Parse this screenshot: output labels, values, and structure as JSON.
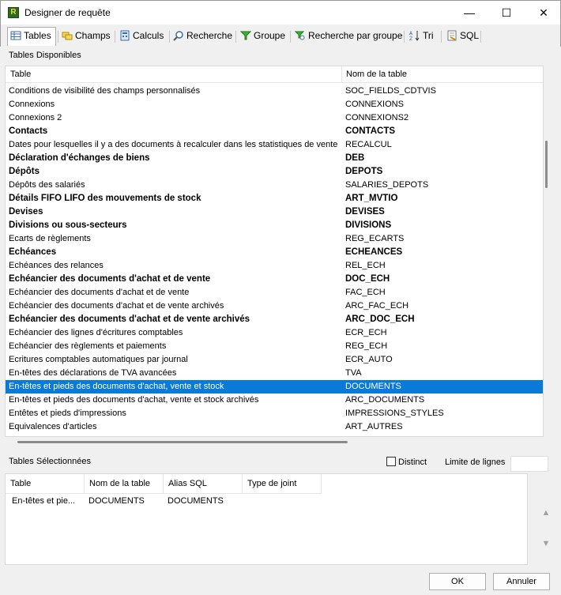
{
  "window": {
    "title": "Designer de requête",
    "app_icon_letter": "R",
    "minimize_glyph": "—",
    "maximize_glyph": "☐",
    "close_glyph": "✕"
  },
  "tabs": [
    {
      "label": "Tables",
      "icon": "table-icon",
      "active": true
    },
    {
      "label": "Champs",
      "icon": "fields-icon",
      "active": false
    },
    {
      "label": "Calculs",
      "icon": "calculator-icon",
      "active": false
    },
    {
      "label": "Recherche",
      "icon": "magnifier-icon",
      "active": false
    },
    {
      "label": "Groupe",
      "icon": "funnel-icon",
      "active": false
    },
    {
      "label": "Recherche par groupe",
      "icon": "group-search-icon",
      "active": false
    },
    {
      "label": "Tri",
      "icon": "sort-az-icon",
      "active": false
    },
    {
      "label": "SQL",
      "icon": "sql-icon",
      "active": false
    }
  ],
  "available": {
    "label": "Tables Disponibles",
    "columns": [
      "Table",
      "Nom de la table"
    ],
    "rows": [
      {
        "name": "Conditions de visibilité des champs personnalisés",
        "table": "SOC_FIELDS_CDTVIS",
        "bold": false,
        "selected": false
      },
      {
        "name": "Connexions",
        "table": "CONNEXIONS",
        "bold": false,
        "selected": false
      },
      {
        "name": "Connexions 2",
        "table": "CONNEXIONS2",
        "bold": false,
        "selected": false
      },
      {
        "name": "Contacts",
        "table": "CONTACTS",
        "bold": true,
        "selected": false
      },
      {
        "name": "Dates pour lesquelles il y a des documents à recalculer dans les statistiques de vente",
        "table": "RECALCUL",
        "bold": false,
        "selected": false
      },
      {
        "name": "Déclaration d'échanges de biens",
        "table": "DEB",
        "bold": true,
        "selected": false
      },
      {
        "name": "Dépôts",
        "table": "DEPOTS",
        "bold": true,
        "selected": false
      },
      {
        "name": "Dépôts des salariés",
        "table": "SALARIES_DEPOTS",
        "bold": false,
        "selected": false
      },
      {
        "name": "Détails FIFO LIFO des mouvements de stock",
        "table": "ART_MVTIO",
        "bold": true,
        "selected": false
      },
      {
        "name": "Devises",
        "table": "DEVISES",
        "bold": true,
        "selected": false
      },
      {
        "name": "Divisions ou sous-secteurs",
        "table": "DIVISIONS",
        "bold": true,
        "selected": false
      },
      {
        "name": "Ecarts de règlements",
        "table": "REG_ECARTS",
        "bold": false,
        "selected": false
      },
      {
        "name": "Echéances",
        "table": "ECHEANCES",
        "bold": true,
        "selected": false
      },
      {
        "name": "Echéances des relances",
        "table": "REL_ECH",
        "bold": false,
        "selected": false
      },
      {
        "name": "Echéancier des documents d'achat et de vente",
        "table": "DOC_ECH",
        "bold": true,
        "selected": false
      },
      {
        "name": "Echéancier des documents d'achat et de vente",
        "table": "FAC_ECH",
        "bold": false,
        "selected": false
      },
      {
        "name": "Echéancier des documents d'achat et de vente archivés",
        "table": "ARC_FAC_ECH",
        "bold": false,
        "selected": false
      },
      {
        "name": "Echéancier des documents d'achat et de vente archivés",
        "table": "ARC_DOC_ECH",
        "bold": true,
        "selected": false
      },
      {
        "name": "Echéancier des lignes d'écritures comptables",
        "table": "ECR_ECH",
        "bold": false,
        "selected": false
      },
      {
        "name": "Echéancier des règlements et paiements",
        "table": "REG_ECH",
        "bold": false,
        "selected": false
      },
      {
        "name": "Ecritures comptables automatiques par journal",
        "table": "ECR_AUTO",
        "bold": false,
        "selected": false
      },
      {
        "name": "En-têtes des déclarations de TVA avancées",
        "table": "TVA",
        "bold": false,
        "selected": false
      },
      {
        "name": "En-têtes et pieds des documents d'achat, vente et stock",
        "table": "DOCUMENTS",
        "bold": false,
        "selected": true
      },
      {
        "name": "En-têtes et pieds des documents d'achat, vente et stock archivés",
        "table": "ARC_DOCUMENTS",
        "bold": false,
        "selected": false
      },
      {
        "name": "Entêtes et pieds d'impressions",
        "table": "IMPRESSIONS_STYLES",
        "bold": false,
        "selected": false
      },
      {
        "name": "Equivalences d'articles",
        "table": "ART_AUTRES",
        "bold": false,
        "selected": false
      }
    ]
  },
  "selected_section": {
    "label": "Tables Sélectionnées",
    "distinct_label": "Distinct",
    "distinct_checked": false,
    "limit_label": "Limite de lignes",
    "limit_value": "",
    "columns": [
      "Table",
      "Nom de la table",
      "Alias SQL",
      "Type de joint"
    ],
    "rows": [
      {
        "table": "En-têtes et pie...",
        "name": "DOCUMENTS",
        "alias": "DOCUMENTS",
        "join": ""
      }
    ],
    "up_glyph": "▲",
    "down_glyph": "▼"
  },
  "buttons": {
    "ok": "OK",
    "cancel": "Annuler"
  }
}
